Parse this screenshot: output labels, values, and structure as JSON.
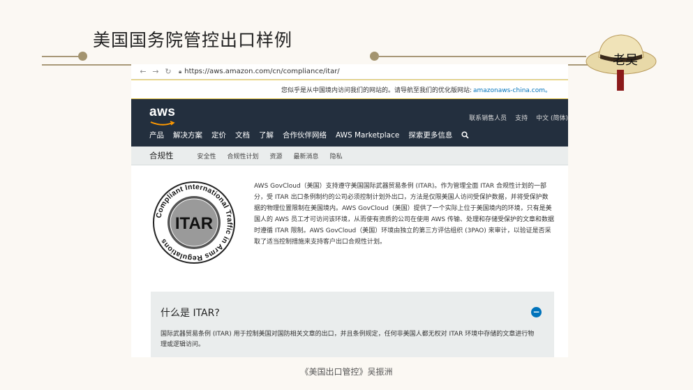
{
  "slide": {
    "title": "美国国务院管控出口样例",
    "caption": "《美国出口管控》吴振洲",
    "hat_text": "老吴"
  },
  "browser": {
    "url": "https://aws.amazon.com/cn/compliance/itar/"
  },
  "banner": {
    "text": "您似乎是从中国境内访问我们的网站的。请导航至我们的优化版网站:",
    "link": "amazonaws-china.com。"
  },
  "header": {
    "logo": "aws",
    "top_links": [
      "联系销售人员",
      "支持",
      "中文 (简体)"
    ],
    "nav": [
      "产品",
      "解决方案",
      "定价",
      "文档",
      "了解",
      "合作伙伴网络",
      "AWS Marketplace",
      "探索更多信息"
    ]
  },
  "subnav": {
    "brand": "合规性",
    "items": [
      "安全性",
      "合规性计划",
      "资源",
      "最新消息",
      "隐私"
    ]
  },
  "seal": {
    "center": "ITAR",
    "ring": "Compliant International Traffic in Arms Regulations"
  },
  "intro": {
    "text": "AWS GovCloud（美国）支持遵守美国国际武器贸易条例 (ITAR)。作为管理全面 ITAR 合规性计划的一部分，受 ITAR 出口条例制约的公司必须控制计划外出口，方法是仅限美国人访问受保护数据，并将受保护数据的物理位置限制在美国境内。AWS GovCloud（美国）提供了一个实际上位于美国境内的环境，只有是美国人的 AWS 员工才可访问该环境，从而使有资质的公司在使用 AWS 传输、处理和存储受保护的文章和数据时遵循 ITAR 限制。AWS GovCloud（美国）环境由独立的第三方评估组织 (3PAO) 来审计，以验证是否采取了适当控制措施来支持客户出口合规性计划。"
  },
  "faq": {
    "title": "什么是 ITAR?",
    "toggle": "−",
    "body": "国际武器贸易条例 (ITAR) 用于控制美国对国防相关文章的出口，并且条例规定，任何非美国人都无权对 ITAR 环境中存储的文章进行物理或逻辑访问。"
  },
  "colors": {
    "aws_header": "#232f3e",
    "aws_orange": "#ff9900",
    "link_blue": "#0073bb",
    "banner_border": "#e8c94a"
  }
}
